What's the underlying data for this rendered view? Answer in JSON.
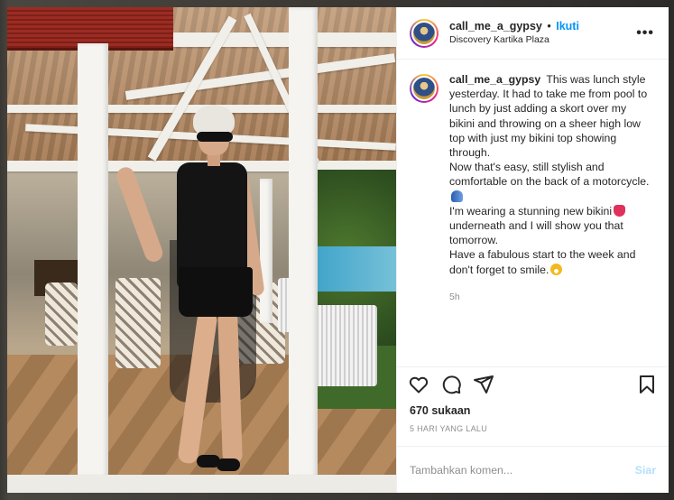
{
  "post": {
    "username": "call_me_a_gypsy",
    "separator": "•",
    "follow_label": "Ikuti",
    "location": "Discovery Kartika Plaza",
    "more_icon": "more-horizontal-icon"
  },
  "caption": {
    "username": "call_me_a_gypsy",
    "lines": [
      "This was lunch style yesterday. It had to take me from pool to lunch by just adding a skort over my bikini and throwing on a sheer high low top with just my bikini top showing through.",
      "Now that's easy, still stylish and comfortable on the back of a motorcycle.",
      "I'm wearing a stunning new bikini",
      "underneath and I will show you that tomorrow.",
      "Have a fabulous start to the week and don't forget to smile."
    ],
    "time_ago": "5h"
  },
  "actions": {
    "like_icon": "heart-icon",
    "comment_icon": "comment-icon",
    "share_icon": "send-icon",
    "save_icon": "bookmark-icon"
  },
  "likes_text": "670 sukaan",
  "date_text": "5 HARI YANG LALU",
  "comment_box": {
    "placeholder": "Tambahkan komen...",
    "post_label": "Siar"
  },
  "colors": {
    "link_blue": "#0095f6",
    "post_disabled": "#b2dffc",
    "muted": "#8e8e8e",
    "text": "#262626"
  }
}
